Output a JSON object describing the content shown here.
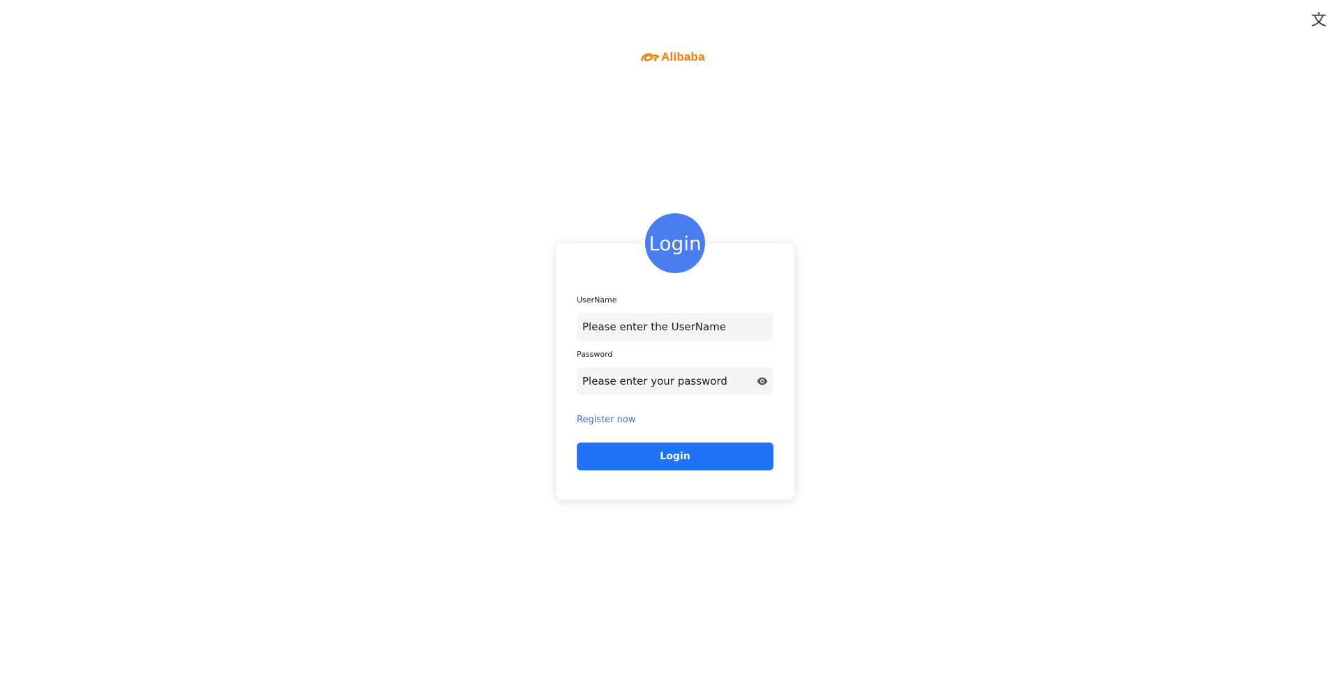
{
  "header": {
    "language_icon": "translate-icon",
    "language_glyph": "文"
  },
  "logo": {
    "text": "Alibaba",
    "icon": "alibaba-logo-icon",
    "color": "#f57c00"
  },
  "login_card": {
    "badge_label": "Login",
    "badge_color": "#4a7ef0",
    "username": {
      "label": "UserName",
      "placeholder": "Please enter the UserName",
      "value": ""
    },
    "password": {
      "label": "Password",
      "placeholder": "Please enter your password",
      "value": "",
      "toggle_icon": "eye-icon"
    },
    "register_label": "Register now",
    "register_color": "#3f6fd8",
    "login_button_label": "Login",
    "login_button_color": "#1f74f6"
  }
}
